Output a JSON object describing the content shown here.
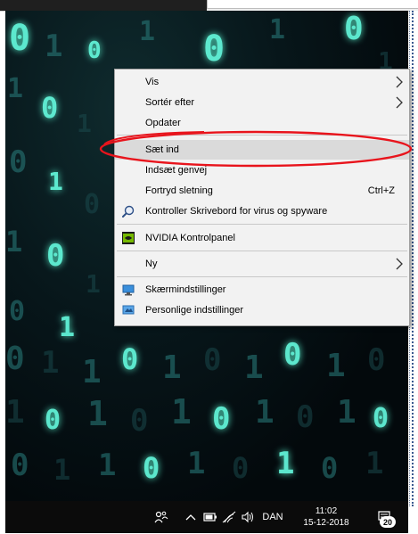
{
  "context_menu": {
    "items": [
      {
        "label": "Vis",
        "submenu": true
      },
      {
        "label": "Sortér efter",
        "submenu": true
      },
      {
        "label": "Opdater"
      },
      {
        "label": "Sæt ind"
      },
      {
        "label": "Indsæt genvej"
      },
      {
        "label": "Fortryd sletning",
        "shortcut": "Ctrl+Z"
      },
      {
        "label": "Kontroller Skrivebord for virus og spyware",
        "icon": "magnifier-shield-icon"
      },
      {
        "label": "NVIDIA Kontrolpanel",
        "icon": "nvidia-icon"
      },
      {
        "label": "Ny",
        "submenu": true
      },
      {
        "label": "Skærmindstillinger",
        "icon": "display-settings-icon"
      },
      {
        "label": "Personlige indstillinger",
        "icon": "personalize-icon"
      }
    ],
    "highlighted": "Sæt ind"
  },
  "taskbar": {
    "language": "DAN",
    "time": "11:02",
    "date": "15-12-2018",
    "notification_count": "20"
  },
  "colors": {
    "annotation": "#e8141c",
    "menu_bg": "#f2f2f2",
    "highlight": "#dadada",
    "taskbar_bg": "#0b0b0b",
    "wallpaper_glow": "#66ffe2"
  }
}
